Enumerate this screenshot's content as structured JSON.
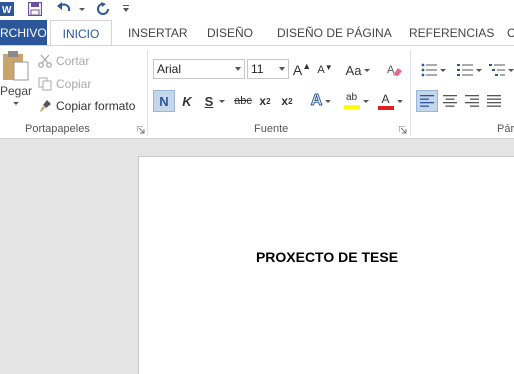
{
  "ribbon_tabs": {
    "file": "RCHIVO",
    "home": "INICIO",
    "insert": "INSERTAR",
    "design": "DISEÑO",
    "layout": "DISEÑO DE PÁGINA",
    "references": "REFERENCIAS",
    "next_partial": "C"
  },
  "clipboard": {
    "paste": "Pegar",
    "cut": "Cortar",
    "copy": "Copiar",
    "format_painter": "Copiar formato",
    "group_label": "Portapapeles"
  },
  "font": {
    "family": "Arial",
    "size": "11",
    "change_case": "Aa",
    "bold": "N",
    "italic": "K",
    "underline": "S",
    "strikethrough": "abc",
    "subscript_base": "x",
    "subscript_mark": "2",
    "superscript_base": "x",
    "superscript_mark": "2",
    "grow": "A",
    "shrink": "A",
    "text_effects": "A",
    "highlight": "ab",
    "font_color": "A",
    "group_label": "Fuente"
  },
  "paragraph": {
    "group_label_partial": "Pár"
  },
  "document": {
    "title": "PROXECTO DE TESE"
  },
  "colors": {
    "brand": "#2b579a",
    "highlight": "#ffff00",
    "font_color": "#e02020"
  }
}
